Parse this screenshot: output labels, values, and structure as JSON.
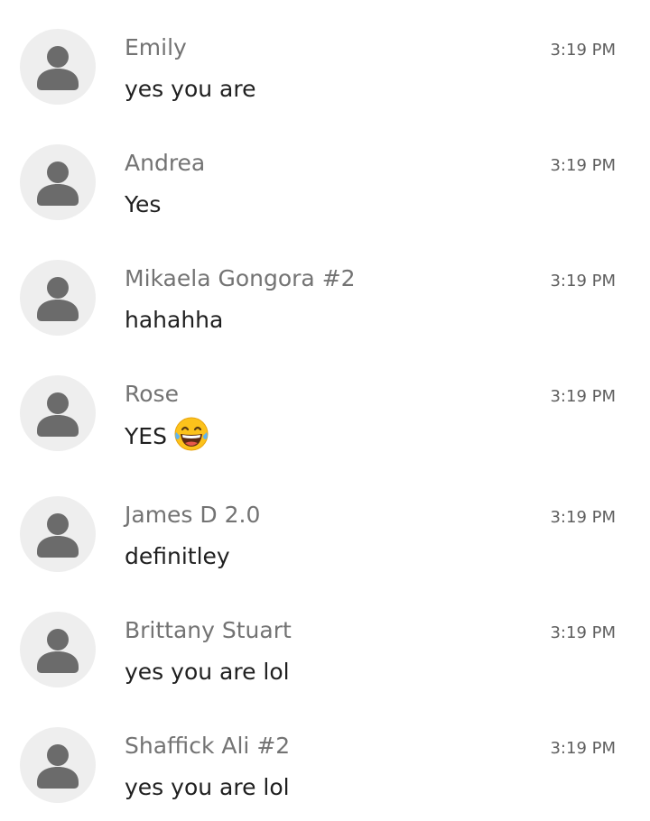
{
  "messages": [
    {
      "sender": "Emily",
      "text": "yes you are",
      "time": "3:19 PM",
      "icon": "person-icon"
    },
    {
      "sender": "Andrea",
      "text": "Yes",
      "time": "3:19 PM",
      "icon": "person-icon"
    },
    {
      "sender": "Mikaela Gongora #2",
      "text": "hahahha",
      "time": "3:19 PM",
      "icon": "person-icon"
    },
    {
      "sender": "Rose",
      "text": "YES",
      "emoji": "face-with-tears-of-joy",
      "time": "3:19 PM",
      "icon": "person-icon"
    },
    {
      "sender": "James D 2.0",
      "text": "definitley",
      "time": "3:19 PM",
      "icon": "person-icon"
    },
    {
      "sender": "Brittany Stuart",
      "text": "yes you are lol",
      "time": "3:19 PM",
      "icon": "person-icon"
    },
    {
      "sender": "Shaffick Ali #2",
      "text": "yes you are lol",
      "time": "3:19 PM",
      "icon": "person-icon"
    }
  ],
  "colors": {
    "avatar_bg": "#eeeeee",
    "avatar_glyph": "#6b6b6b",
    "sender": "#737373",
    "text": "#1f1f1f",
    "time": "#5f5f5f"
  }
}
